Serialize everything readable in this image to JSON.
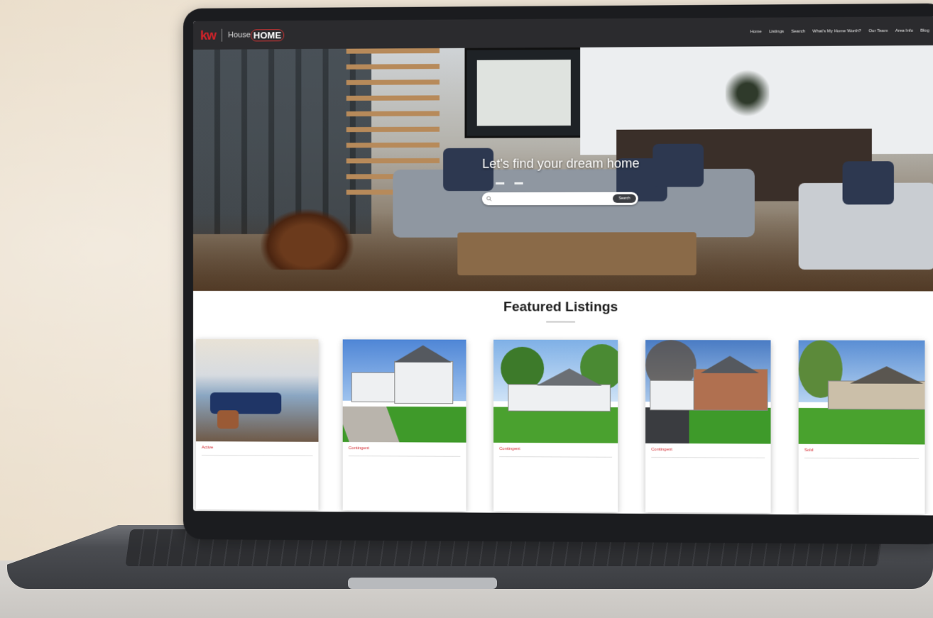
{
  "header": {
    "logo_kw": "kw",
    "logo_house": "House",
    "logo_home": "HOME",
    "nav": [
      "Home",
      "Listings",
      "Search",
      "What's My Home Worth?",
      "Our Team",
      "Area Info",
      "Blog"
    ]
  },
  "hero": {
    "title": "Let's find your dream home",
    "search_placeholder": "",
    "search_button": "Search"
  },
  "featured": {
    "title": "Featured Listings"
  },
  "listings": [
    {
      "status": "Active",
      "price": "",
      "address_line1": "",
      "address_line2": "",
      "details": "",
      "courtesy": ""
    },
    {
      "status": "Contingent",
      "price": "",
      "address_line1": "",
      "address_line2": "",
      "details": "",
      "courtesy": ""
    },
    {
      "status": "Contingent",
      "price": "",
      "address_line1": "",
      "address_line2": "",
      "details": "",
      "courtesy": ""
    },
    {
      "status": "Contingent",
      "price": "",
      "address_line1": "",
      "address_line2": "",
      "details": "",
      "courtesy": ""
    },
    {
      "status": "Sold",
      "price": "",
      "address_line1": "",
      "address_line2": "",
      "details": "",
      "courtesy": ""
    }
  ],
  "colors": {
    "brand_red": "#d2232a",
    "navbar": "#2b2b2e",
    "laptop_bezel": "#1b1c1f"
  },
  "icons": [
    "search-icon"
  ]
}
